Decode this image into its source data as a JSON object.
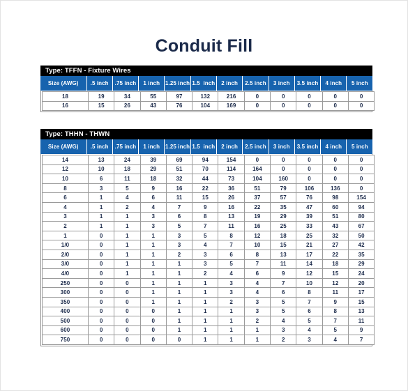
{
  "page": {
    "title": "Conduit Fill",
    "background_color": "#ffffff",
    "title_color": "#1b2a4a"
  },
  "style": {
    "caption_bg": "#000000",
    "caption_fg": "#ffffff",
    "header_bg": "#1763ae",
    "header_fg": "#ffffff",
    "cell_fg": "#1b2a4a",
    "cell_border": "#9a9a9a"
  },
  "columns": [
    "Size (AWG)",
    ".5 inch",
    ".75 inch",
    "1 inch",
    "1.25 inch",
    "1.5  inch",
    "2 inch",
    "2.5 inch",
    "3 inch",
    "3.5 inch",
    "4 inch",
    "5 inch"
  ],
  "tables": [
    {
      "id": "tffn",
      "caption": "Type: TFFN - Fixture Wires",
      "rows": [
        [
          "18",
          "19",
          "34",
          "55",
          "97",
          "132",
          "216",
          "0",
          "0",
          "0",
          "0",
          "0"
        ],
        [
          "16",
          "15",
          "26",
          "43",
          "76",
          "104",
          "169",
          "0",
          "0",
          "0",
          "0",
          "0"
        ]
      ]
    },
    {
      "id": "thhn",
      "caption": "Type: THHN - THWN",
      "rows": [
        [
          "14",
          "13",
          "24",
          "39",
          "69",
          "94",
          "154",
          "0",
          "0",
          "0",
          "0",
          "0"
        ],
        [
          "12",
          "10",
          "18",
          "29",
          "51",
          "70",
          "114",
          "164",
          "0",
          "0",
          "0",
          "0"
        ],
        [
          "10",
          "6",
          "11",
          "18",
          "32",
          "44",
          "73",
          "104",
          "160",
          "0",
          "0",
          "0"
        ],
        [
          "8",
          "3",
          "5",
          "9",
          "16",
          "22",
          "36",
          "51",
          "79",
          "106",
          "136",
          "0"
        ],
        [
          "6",
          "1",
          "4",
          "6",
          "11",
          "15",
          "26",
          "37",
          "57",
          "76",
          "98",
          "154"
        ],
        [
          "4",
          "1",
          "2",
          "4",
          "7",
          "9",
          "16",
          "22",
          "35",
          "47",
          "60",
          "94"
        ],
        [
          "3",
          "1",
          "1",
          "3",
          "6",
          "8",
          "13",
          "19",
          "29",
          "39",
          "51",
          "80"
        ],
        [
          "2",
          "1",
          "1",
          "3",
          "5",
          "7",
          "11",
          "16",
          "25",
          "33",
          "43",
          "67"
        ],
        [
          "1",
          "0",
          "1",
          "1",
          "3",
          "5",
          "8",
          "12",
          "18",
          "25",
          "32",
          "50"
        ],
        [
          "1/0",
          "0",
          "1",
          "1",
          "3",
          "4",
          "7",
          "10",
          "15",
          "21",
          "27",
          "42"
        ],
        [
          "2/0",
          "0",
          "1",
          "1",
          "2",
          "3",
          "6",
          "8",
          "13",
          "17",
          "22",
          "35"
        ],
        [
          "3/0",
          "0",
          "1",
          "1",
          "1",
          "3",
          "5",
          "7",
          "11",
          "14",
          "18",
          "29"
        ],
        [
          "4/0",
          "0",
          "1",
          "1",
          "1",
          "2",
          "4",
          "6",
          "9",
          "12",
          "15",
          "24"
        ],
        [
          "250",
          "0",
          "0",
          "1",
          "1",
          "1",
          "3",
          "4",
          "7",
          "10",
          "12",
          "20"
        ],
        [
          "300",
          "0",
          "0",
          "1",
          "1",
          "1",
          "3",
          "4",
          "6",
          "8",
          "11",
          "17"
        ],
        [
          "350",
          "0",
          "0",
          "1",
          "1",
          "1",
          "2",
          "3",
          "5",
          "7",
          "9",
          "15"
        ],
        [
          "400",
          "0",
          "0",
          "0",
          "1",
          "1",
          "1",
          "3",
          "5",
          "6",
          "8",
          "13"
        ],
        [
          "500",
          "0",
          "0",
          "0",
          "1",
          "1",
          "1",
          "2",
          "4",
          "5",
          "7",
          "11"
        ],
        [
          "600",
          "0",
          "0",
          "0",
          "1",
          "1",
          "1",
          "1",
          "3",
          "4",
          "5",
          "9"
        ],
        [
          "750",
          "0",
          "0",
          "0",
          "0",
          "1",
          "1",
          "1",
          "2",
          "3",
          "4",
          "7"
        ]
      ]
    }
  ]
}
